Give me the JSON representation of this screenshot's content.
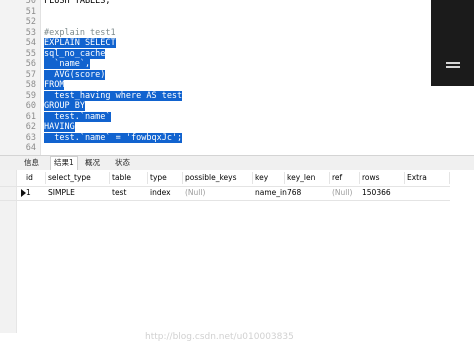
{
  "editor": {
    "line_numbers": [
      "50",
      "51",
      "52",
      "53",
      "54",
      "55",
      "56",
      "57",
      "58",
      "59",
      "60",
      "61",
      "62",
      "63",
      "64"
    ],
    "lines": [
      {
        "text": "FLUSH TABLES;",
        "style": "plain"
      },
      {
        "text": "",
        "style": "plain"
      },
      {
        "text": "",
        "style": "plain"
      },
      {
        "text": "#explain test1",
        "style": "comment"
      },
      {
        "text": "EXPLAIN SELECT",
        "style": "selected"
      },
      {
        "text": "sql_no_cache",
        "style": "selected"
      },
      {
        "text": "  `name`,",
        "style": "selected"
      },
      {
        "text": "  AVG(score)",
        "style": "selected"
      },
      {
        "text": "FROM",
        "style": "selected"
      },
      {
        "text": "  test_having where AS test",
        "style": "selected"
      },
      {
        "text": "GROUP BY",
        "style": "selected"
      },
      {
        "text": "  test.`name`",
        "style": "selected"
      },
      {
        "text": "HAVING",
        "style": "selected"
      },
      {
        "text": "  test.`name` = 'fowbqxJc';",
        "style": "selected"
      },
      {
        "text": "",
        "style": "plain"
      }
    ]
  },
  "result_tabs": [
    {
      "label": "信息",
      "active": false
    },
    {
      "label": "结果1",
      "active": true
    },
    {
      "label": "概况",
      "active": false
    },
    {
      "label": "状态",
      "active": false
    }
  ],
  "grid": {
    "columns": [
      "id",
      "select_type",
      "table",
      "type",
      "possible_keys",
      "key",
      "key_len",
      "ref",
      "rows",
      "Extra"
    ],
    "row": [
      "1",
      "SIMPLE",
      "test",
      "index",
      "(Null)",
      "name_in",
      "768",
      "(Null)",
      "150366",
      ""
    ]
  },
  "watermark": "http://blog.csdn.net/u010003835"
}
